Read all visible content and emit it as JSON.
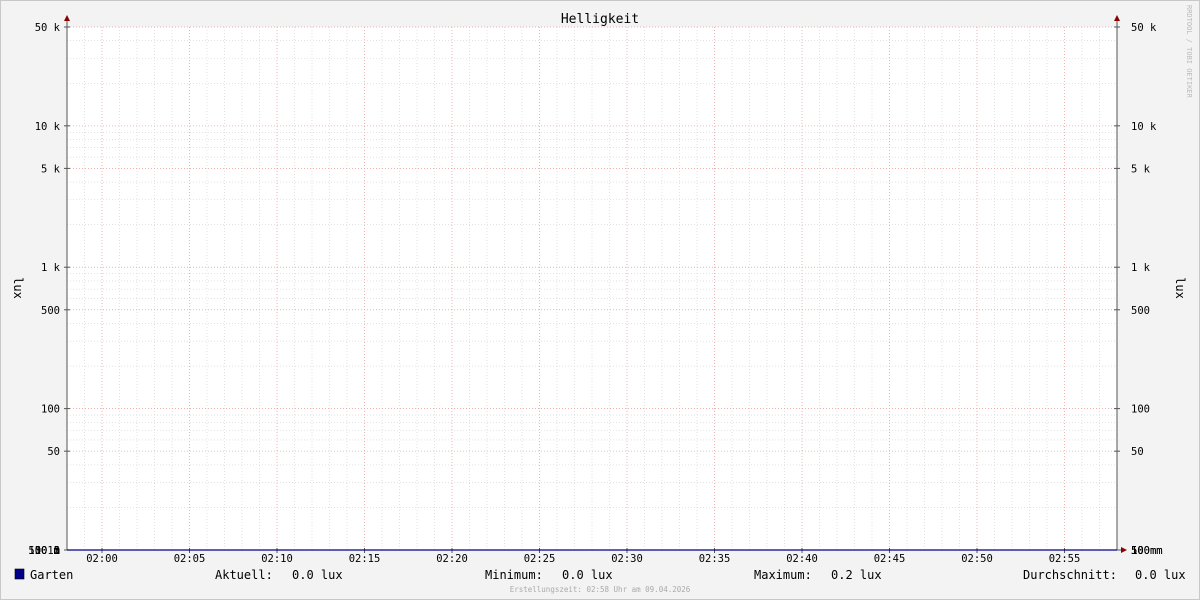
{
  "chart_data": {
    "type": "line",
    "title": "Helligkeit",
    "ylabel": "lux",
    "y_scale": "log",
    "ylim": [
      10,
      50000
    ],
    "x_range": [
      "01:58",
      "02:58"
    ],
    "x_ticks": [
      "02:00",
      "02:05",
      "02:10",
      "02:15",
      "02:20",
      "02:25",
      "02:30",
      "02:35",
      "02:40",
      "02:45",
      "02:50",
      "02:55"
    ],
    "y_ticks": [
      {
        "value": 50000,
        "label": "50 k"
      },
      {
        "value": 10000,
        "label": "10 k"
      },
      {
        "value": 5000,
        "label": "5 k"
      },
      {
        "value": 1000,
        "label": "1 k"
      },
      {
        "value": 500,
        "label": "500"
      },
      {
        "value": 100,
        "label": "100"
      },
      {
        "value": 50,
        "label": "50"
      },
      {
        "value": 10,
        "label": "10"
      },
      {
        "value": 5,
        "label": "5"
      },
      {
        "value": 1,
        "label": "1"
      },
      {
        "value": 0.5,
        "label": "500 m"
      },
      {
        "value": 0.1,
        "label": "100 m"
      },
      {
        "value": 0.05,
        "label": "50 m"
      },
      {
        "value": 0.01,
        "label": "10 m"
      }
    ],
    "grid": true,
    "series": [
      {
        "name": "Garten",
        "color": "#00008b",
        "x": [
          "01:58",
          "02:24",
          "02:24",
          "02:26",
          "02:26",
          "02:28",
          "02:28",
          "02:58"
        ],
        "values": [
          0.0,
          0.0,
          0.18,
          0.18,
          0.19,
          0.19,
          0.0,
          0.0
        ]
      }
    ]
  },
  "legend": {
    "series_name": "Garten",
    "series_color": "#00008b",
    "current_label": "Aktuell:",
    "current_value": "0.0 lux",
    "min_label": "Minimum:",
    "min_value": "0.0 lux",
    "max_label": "Maximum:",
    "max_value": "0.2 lux",
    "avg_label": "Durchschnitt:",
    "avg_value": "0.0 lux"
  },
  "footer": "Erstellungszeit: 02:58 Uhr am 09.04.2026",
  "watermark": "RRDTOOL / TOBI OETIKER",
  "colors": {
    "major_grid": "#f0a0a0",
    "minor_grid": "#d0d0d0",
    "axis": "#555555",
    "arrow": "#8b0000"
  }
}
